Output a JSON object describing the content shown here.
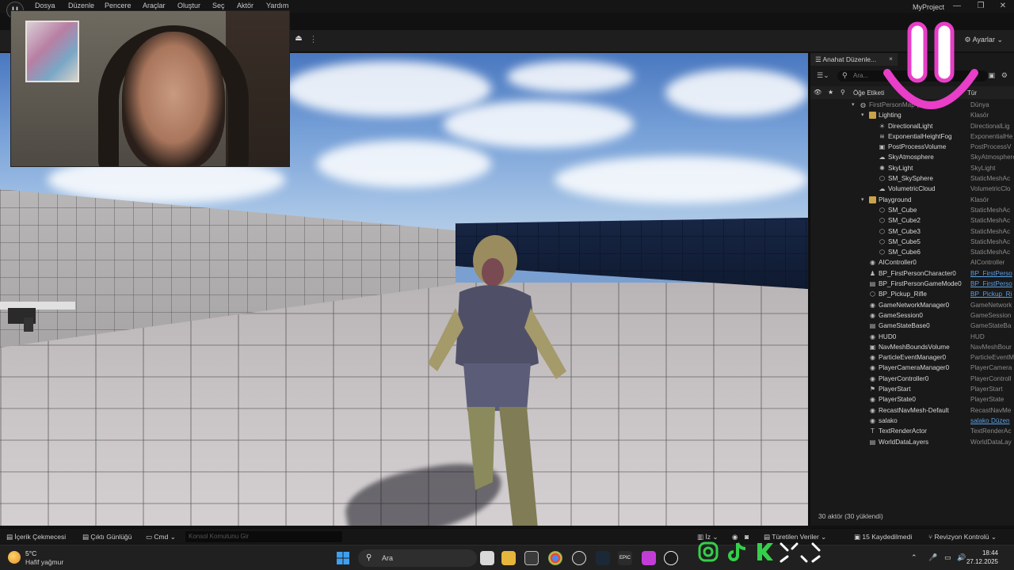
{
  "menu": {
    "logo_text": "U",
    "items": [
      "Dosya",
      "Düzenle",
      "Pencere",
      "Araçlar",
      "Oluştur",
      "Seç",
      "Aktör",
      "Yardım"
    ],
    "project_name": "MyProject",
    "minimize": "—",
    "restore": "❐",
    "close": "✕"
  },
  "toolbar": {
    "eject_glyph": "⏏",
    "kebab": "⋮",
    "settings_label": "Ayarlar"
  },
  "outliner": {
    "tab_title": "Anahat Düzenle...",
    "tab_close": "×",
    "search_placeholder": "Ara...",
    "col_label": "Öğe Etiketi",
    "col_type": "Tür",
    "footer": "30 aktör (30 yüklendi)",
    "rows": [
      {
        "label": "FirstPersonMap (Editör)",
        "type": "Dünya",
        "depth": 0,
        "kind": "world",
        "expand": "open",
        "icon": "▾"
      },
      {
        "label": "Lighting",
        "type": "Klasör",
        "depth": 1,
        "kind": "folder",
        "expand": "open",
        "icon": "▾"
      },
      {
        "label": "DirectionalLight",
        "type": "DirectionalLig",
        "depth": 2,
        "kind": "actor",
        "icon": "☀"
      },
      {
        "label": "ExponentialHeightFog",
        "type": "ExponentialHe",
        "depth": 2,
        "kind": "actor",
        "icon": "≋"
      },
      {
        "label": "PostProcessVolume",
        "type": "PostProcessV",
        "depth": 2,
        "kind": "actor",
        "icon": "▣"
      },
      {
        "label": "SkyAtmosphere",
        "type": "SkyAtmosphere",
        "depth": 2,
        "kind": "actor",
        "icon": "☁"
      },
      {
        "label": "SkyLight",
        "type": "SkyLight",
        "depth": 2,
        "kind": "actor",
        "icon": "✺"
      },
      {
        "label": "SM_SkySphere",
        "type": "StaticMeshAc",
        "depth": 2,
        "kind": "actor",
        "icon": "⬡"
      },
      {
        "label": "VolumetricCloud",
        "type": "VolumetricClo",
        "depth": 2,
        "kind": "actor",
        "icon": "☁"
      },
      {
        "label": "Playground",
        "type": "Klasör",
        "depth": 1,
        "kind": "folder",
        "expand": "open",
        "icon": "▾"
      },
      {
        "label": "SM_Cube",
        "type": "StaticMeshAc",
        "depth": 2,
        "kind": "actor",
        "icon": "⬡"
      },
      {
        "label": "SM_Cube2",
        "type": "StaticMeshAc",
        "depth": 2,
        "kind": "actor",
        "icon": "⬡"
      },
      {
        "label": "SM_Cube3",
        "type": "StaticMeshAc",
        "depth": 2,
        "kind": "actor",
        "icon": "⬡"
      },
      {
        "label": "SM_Cube5",
        "type": "StaticMeshAc",
        "depth": 2,
        "kind": "actor",
        "icon": "⬡"
      },
      {
        "label": "SM_Cube6",
        "type": "StaticMeshAc",
        "depth": 2,
        "kind": "actor",
        "icon": "⬡"
      },
      {
        "label": "AIController0",
        "type": "AIController",
        "depth": 1,
        "kind": "actor",
        "icon": "◉"
      },
      {
        "label": "BP_FirstPersonCharacter0",
        "type": "BP_FirstPerso",
        "depth": 1,
        "kind": "actor",
        "icon": "♟",
        "link": true
      },
      {
        "label": "BP_FirstPersonGameMode0",
        "type": "BP_FirstPerso",
        "depth": 1,
        "kind": "actor",
        "icon": "▤",
        "link": true
      },
      {
        "label": "BP_Pickup_Rifle",
        "type": "BP_Pickup_Ri",
        "depth": 1,
        "kind": "actor",
        "icon": "⬡",
        "link": true
      },
      {
        "label": "GameNetworkManager0",
        "type": "GameNetwork",
        "depth": 1,
        "kind": "actor",
        "icon": "◉"
      },
      {
        "label": "GameSession0",
        "type": "GameSession",
        "depth": 1,
        "kind": "actor",
        "icon": "◉"
      },
      {
        "label": "GameStateBase0",
        "type": "GameStateBa",
        "depth": 1,
        "kind": "actor",
        "icon": "▤"
      },
      {
        "label": "HUD0",
        "type": "HUD",
        "depth": 1,
        "kind": "actor",
        "icon": "◉"
      },
      {
        "label": "NavMeshBoundsVolume",
        "type": "NavMeshBour",
        "depth": 1,
        "kind": "actor",
        "icon": "▣"
      },
      {
        "label": "ParticleEventManager0",
        "type": "ParticleEventM",
        "depth": 1,
        "kind": "actor",
        "icon": "◉"
      },
      {
        "label": "PlayerCameraManager0",
        "type": "PlayerCamera",
        "depth": 1,
        "kind": "actor",
        "icon": "◉"
      },
      {
        "label": "PlayerController0",
        "type": "PlayerControll",
        "depth": 1,
        "kind": "actor",
        "icon": "◉"
      },
      {
        "label": "PlayerStart",
        "type": "PlayerStart",
        "depth": 1,
        "kind": "actor",
        "icon": "⚑"
      },
      {
        "label": "PlayerState0",
        "type": "PlayerState",
        "depth": 1,
        "kind": "actor",
        "icon": "◉"
      },
      {
        "label": "RecastNavMesh-Default",
        "type": "RecastNavMe",
        "depth": 1,
        "kind": "actor",
        "icon": "◉"
      },
      {
        "label": "salako",
        "type": "salako Düzen",
        "depth": 1,
        "kind": "actor",
        "icon": "◉",
        "link": true
      },
      {
        "label": "TextRenderActor",
        "type": "TextRenderAc",
        "depth": 1,
        "kind": "actor",
        "icon": "T"
      },
      {
        "label": "WorldDataLayers",
        "type": "WorldDataLay",
        "depth": 1,
        "kind": "actor",
        "icon": "▤"
      }
    ]
  },
  "bottombar": {
    "content_drawer": "İçerik Çekmecesi",
    "output_log": "Çıktı Günlüğü",
    "cmd": "Cmd",
    "console_placeholder": "Konsol Komutunu Gir",
    "derived_data": "Türetilen Veriler",
    "unsaved": "15 Kaydedilmedi",
    "revision": "Revizyon Kontrolü",
    "iz": "İz"
  },
  "taskbar": {
    "temperature": "5°C",
    "weather": "Hafif yağmur",
    "search_placeholder": "Ara",
    "time": "18:44",
    "date": "27.12.2025"
  },
  "colors": {
    "accent_blue": "#5a9fe6",
    "panel_bg": "#191919",
    "smile_pink": "#e83ec8",
    "folder_yellow": "#c9a24a"
  }
}
